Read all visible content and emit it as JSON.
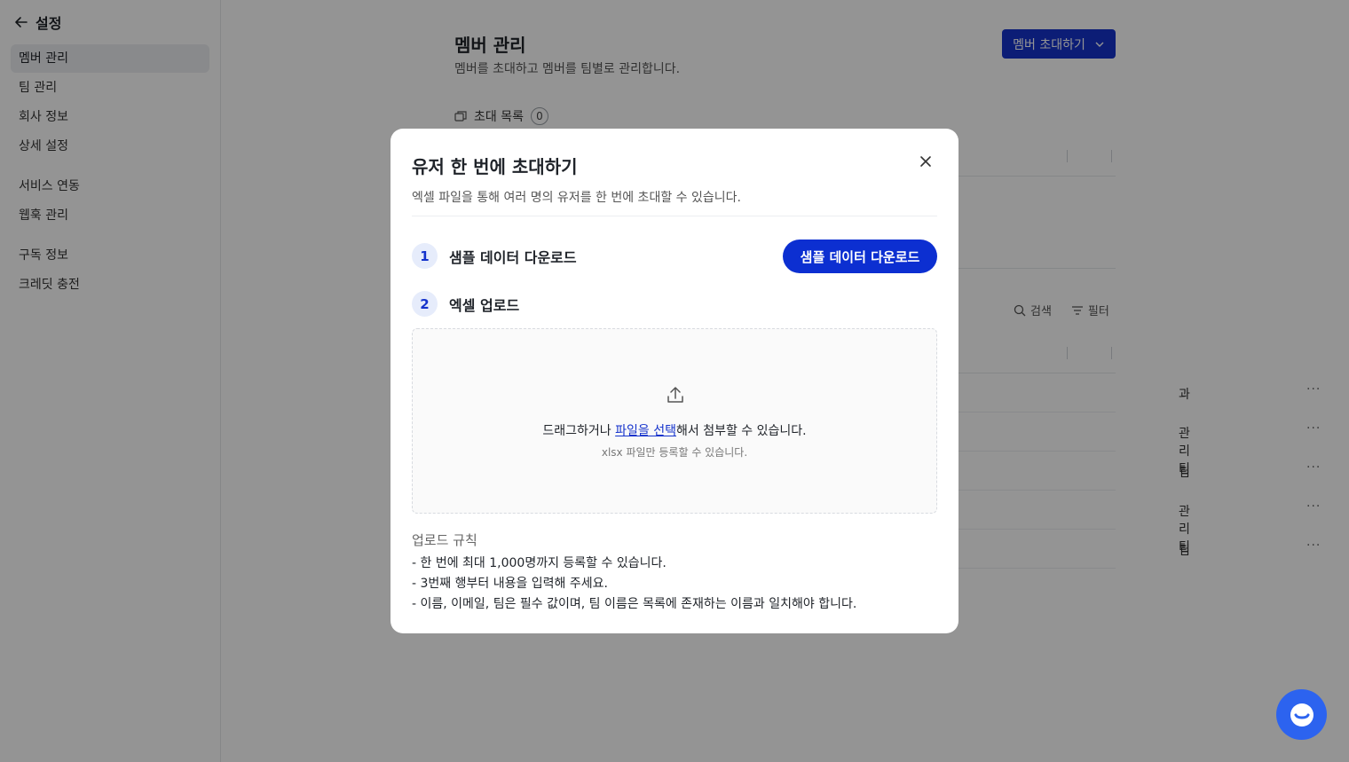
{
  "sidebar": {
    "back_title": "설정",
    "items": [
      {
        "label": "멤버 관리"
      },
      {
        "label": "팀 관리"
      },
      {
        "label": "회사 정보"
      },
      {
        "label": "상세 설정"
      },
      {
        "label": "서비스 연동"
      },
      {
        "label": "웹훅 관리"
      },
      {
        "label": "구독 정보"
      },
      {
        "label": "크레딧 충전"
      }
    ]
  },
  "main": {
    "title": "멤버 관리",
    "description": "멤버를 초대하고 멤버를 팀별로 관리합니다.",
    "invite_button": "멤버 초대하기",
    "invite_list_label": "초대 목록",
    "invite_count": "0",
    "search_label": "검색",
    "filter_label": "필터",
    "rows": [
      {
        "team": "과"
      },
      {
        "team": "관리팀"
      },
      {
        "team": "팀"
      },
      {
        "team": "관리팀"
      },
      {
        "team": "팀"
      }
    ],
    "row_more": "···"
  },
  "modal": {
    "title": "유저 한 번에 초대하기",
    "description": "엑셀 파일을 통해 여러 명의 유저를 한 번에 초대할 수 있습니다.",
    "step1_num": "1",
    "step1_label": "샘플 데이터 다운로드",
    "download_button": "샘플 데이터 다운로드",
    "step2_num": "2",
    "step2_label": "엑셀 업로드",
    "dropzone_prefix": "드래그하거나 ",
    "dropzone_link": "파일을 선택",
    "dropzone_suffix": "해서 첨부할 수 있습니다.",
    "dropzone_sub": "xlsx 파일만 등록할 수 있습니다.",
    "rules_title": "업로드 규칙",
    "rules": [
      "- 한 번에 최대 1,000명까지 등록할 수 있습니다.",
      "- 3번째 행부터 내용을 입력해 주세요.",
      "- 이름, 이메일, 팀은 필수 값이며, 팀 이름은 목록에 존재하는 이름과 일치해야 합니다."
    ]
  },
  "colors": {
    "primary": "#0c2fd1",
    "chat": "#2c63ef"
  },
  "icons": [
    "arrow-left-icon",
    "chevron-down-icon",
    "copy-icon",
    "search-icon",
    "filter-icon",
    "close-icon",
    "upload-icon",
    "chat-icon"
  ]
}
